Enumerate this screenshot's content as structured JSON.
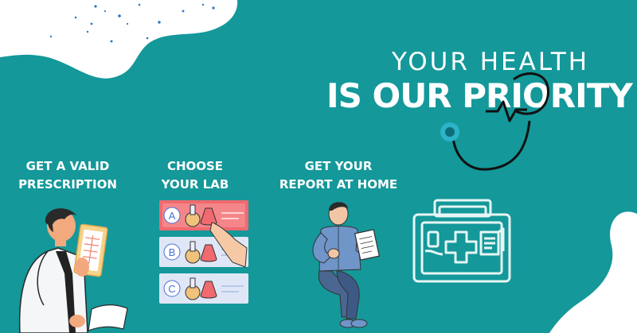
{
  "headline": {
    "line1": "YOUR HEALTH",
    "line2": "IS OUR PRIORITY"
  },
  "steps": [
    {
      "line1": "GET A VALID",
      "line2": "PRESCRIPTION"
    },
    {
      "line1": "CHOOSE",
      "line2": "YOUR LAB"
    },
    {
      "line1": "GET YOUR",
      "line2": "REPORT AT HOME"
    }
  ],
  "lab_options": [
    "A",
    "B",
    "C"
  ],
  "colors": {
    "background": "#14989a",
    "blob": "#ffffff",
    "option_selected": "#f06a6f",
    "option_default": "#dfe7f6",
    "icon_line": "#e6f6f5",
    "stethoscope": "#111111"
  },
  "icons": [
    "stethoscope-icon",
    "medical-kit-icon",
    "doctor-illustration",
    "lab-test-options-illustration",
    "man-reading-report-illustration"
  ]
}
